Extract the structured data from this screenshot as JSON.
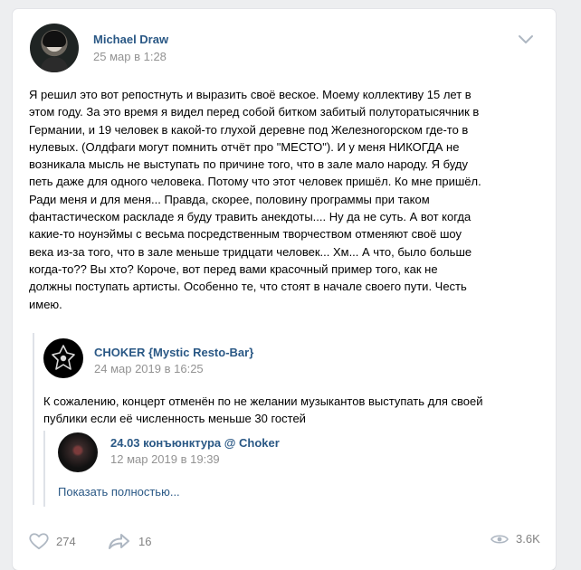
{
  "post": {
    "author": "Michael Draw",
    "date": "25 мар в 1:28",
    "text": "Я решил это вот репостнуть и выразить своё веское. Моему коллективу 15 лет в\nэтом году. За это время я видел перед собой битком забитый полуторатысячник в\nГермании, и 19 человек в какой-то глухой деревне под Железногорском где-то в\nнулевых. (Олдфаги могут помнить отчёт про \"МЕСТО\"). И у меня НИКОГДА не\nвозникала мысль не выступать по причине того, что в зале мало народу. Я буду\nпеть даже для одного человека. Потому что этот человек пришёл. Ко мне пришёл.\nРади меня и для меня... Правда, скорее, половину программы при таком\nфантастическом раскладе я буду травить анекдоты.... Ну да не суть. А вот когда\nкакие-то ноунэймы с весьма посредственным творчеством отменяют своё шоу\nвека из-за того, что в зале меньше тридцати человек... Хм... А что, было больше\nкогда-то?? Вы хто? Короче, вот перед вами красочный пример того, как не\nдолжны поступать артисты. Особенно те, что стоят в начале своего пути. Честь\nимею."
  },
  "repost": {
    "author": "CHOKER {Mystic Resto-Bar}",
    "date": "24 мар 2019 в 16:25",
    "text": "К сожалению, концерт отменён по не желании музыкантов выступать для своей публики если её численность меньше 30 гостей",
    "nested": {
      "author": "24.03 конъюнктура @ Choker",
      "date": "12 мар 2019 в 19:39",
      "show_more": "Показать полностью..."
    }
  },
  "actions": {
    "likes": "274",
    "shares": "16",
    "views": "3.6K"
  },
  "colors": {
    "link": "#2a5885",
    "muted": "#939393",
    "bg": "#edeef0"
  },
  "icons": {
    "more": "chevron-down-icon",
    "like": "heart-icon",
    "share": "share-arrow-icon",
    "views": "eye-icon"
  }
}
